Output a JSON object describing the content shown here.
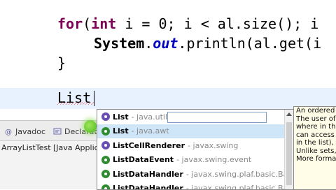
{
  "editor": {
    "line1": {
      "kw": "for",
      "rest1": "(",
      "kw2": "int",
      "rest2": " i = 0; i < al.size(); i"
    },
    "line2": {
      "cls": "System",
      "dot": ".",
      "field": "out",
      "rest": ".println(al.get(i"
    },
    "line3": "}",
    "line4": "List"
  },
  "panel": {
    "tabs": [
      {
        "label": "Javadoc",
        "icon": "at-icon"
      },
      {
        "label": "Declarati",
        "icon": "declaration-icon"
      }
    ],
    "row": "ArrayListTest [Java Applica"
  },
  "assist": {
    "items": [
      {
        "name": "List",
        "pkg": "- java.util",
        "kind": "interface",
        "icon": "interface-icon",
        "selected": false
      },
      {
        "name": "List",
        "pkg": "- java.awt",
        "kind": "class",
        "icon": "class-icon",
        "selected": true
      },
      {
        "name": "ListCellRenderer",
        "pkg": "- javax.swing",
        "kind": "interface",
        "icon": "interface-icon",
        "selected": false
      },
      {
        "name": "ListDataEvent",
        "pkg": "- javax.swing.event",
        "kind": "class",
        "icon": "class-icon",
        "selected": false
      },
      {
        "name": "ListDataHandler",
        "pkg": "- javax.swing.plaf.basic.BasicC",
        "kind": "class",
        "icon": "class-icon",
        "selected": false
      },
      {
        "name": "ListDataHandler",
        "pkg": "- javax.swing.plaf.basic.BasicC",
        "kind": "class",
        "icon": "class-icon",
        "selected": false
      }
    ]
  },
  "doc": {
    "lines": [
      "An ordered",
      "The user of",
      "where in th",
      "can access",
      "in the list),",
      "",
      "Unlike sets,",
      "More forma"
    ]
  },
  "colors": {
    "keyword": "#7f0055",
    "field": "#0000c0",
    "selection": "#cfe6f8",
    "doc_bg": "#fffde7"
  }
}
